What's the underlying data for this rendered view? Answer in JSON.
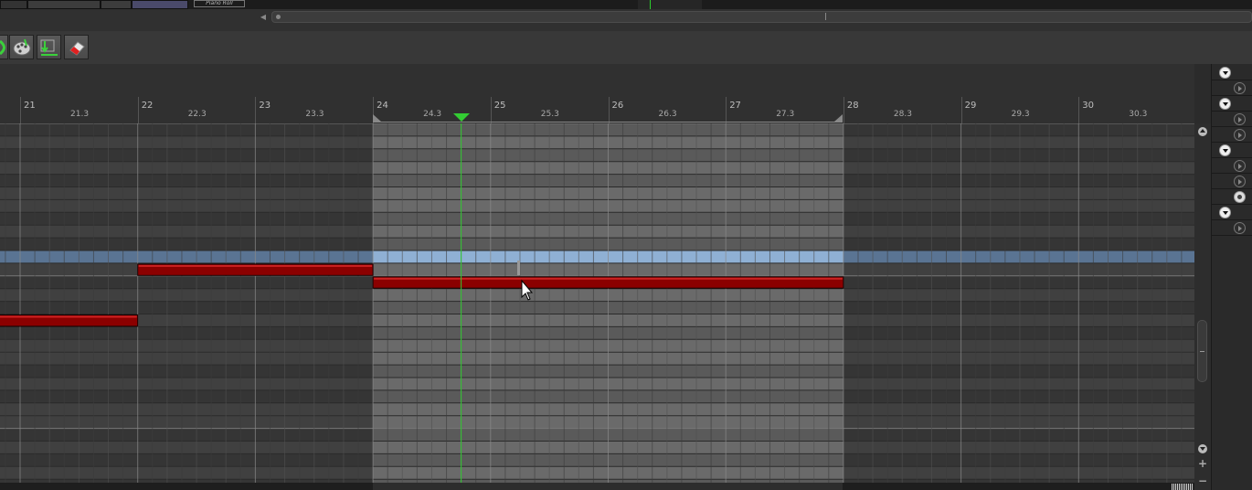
{
  "window": {
    "mini_label": "Piano Roll",
    "accent_green": "#33cc33",
    "note_color": "#8b0000",
    "selected_row_color": "#8fb0d4"
  },
  "toolbar": {
    "tools": [
      {
        "name": "tool-partial-green",
        "icon": "green-tool-icon"
      },
      {
        "name": "tool-paint",
        "icon": "palette-icon"
      },
      {
        "name": "tool-quantize",
        "icon": "quantize-icon"
      },
      {
        "name": "tool-erase",
        "icon": "eraser-icon"
      }
    ]
  },
  "ruler": {
    "bars": [
      {
        "label": "21",
        "sub": "21.3"
      },
      {
        "label": "22",
        "sub": "22.3"
      },
      {
        "label": "23",
        "sub": "23.3"
      },
      {
        "label": "24",
        "sub": "24.3"
      },
      {
        "label": "25",
        "sub": "25.3"
      },
      {
        "label": "26",
        "sub": "26.3"
      },
      {
        "label": "27",
        "sub": "27.3"
      },
      {
        "label": "28",
        "sub": "28.3"
      },
      {
        "label": "29",
        "sub": "29.3"
      },
      {
        "label": "30",
        "sub": "30.3"
      }
    ],
    "first_bar": 21,
    "loop": {
      "start": 24,
      "end": 28
    },
    "playhead": 24.75
  },
  "piano_roll": {
    "rows": 24,
    "selected_row": 10,
    "steps_per_bar": 8,
    "notes": [
      {
        "row": 11,
        "start": 22,
        "end": 24
      },
      {
        "row": 12,
        "start": 24,
        "end": 28
      },
      {
        "row": 15,
        "start": 19.6,
        "end": 22
      }
    ]
  },
  "right_panel": {
    "items": [
      "expand",
      "play",
      "expand",
      "play",
      "play",
      "expand",
      "play",
      "play",
      "active",
      "expand",
      "play"
    ]
  }
}
